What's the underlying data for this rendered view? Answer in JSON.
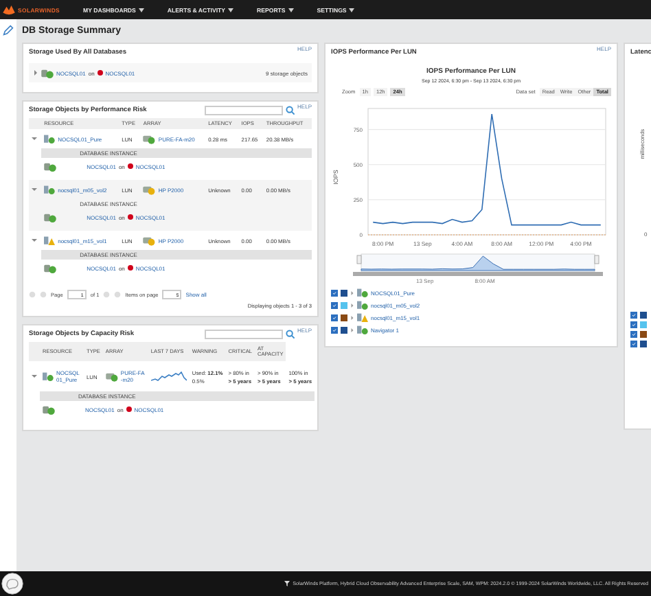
{
  "nav": {
    "logo": "SOLARWINDS",
    "menus": [
      "MY DASHBOARDS",
      "ALERTS & ACTIVITY",
      "REPORTS",
      "SETTINGS"
    ]
  },
  "page_title": "DB Storage Summary",
  "storage_used": {
    "title": "Storage Used By All Databases",
    "help": "HELP",
    "row": {
      "expanded": false,
      "instance": "NOCSQL01",
      "joiner": "on",
      "server": "NOCSQL01",
      "server_down": true,
      "count": "9 storage objects"
    }
  },
  "performance_risk": {
    "title": "Storage Objects by Performance Risk",
    "help": "HELP",
    "columns": [
      "RESOURCE",
      "TYPE",
      "ARRAY",
      "LATENCY",
      "IOPS",
      "THROUGHPUT"
    ],
    "rows": [
      {
        "resource": "NOCSQL01_Pure",
        "resource_warning": false,
        "type": "LUN",
        "array": "PURE-FA-m20",
        "array_warning": false,
        "latency": "0.28 ms",
        "iops": "217.65",
        "throughput": "20.38 MB/s",
        "expanded": true,
        "sub_heading": "DATABASE INSTANCE",
        "instance": "NOCSQL01",
        "joiner": "on",
        "server": "NOCSQL01",
        "server_down": true
      },
      {
        "resource": "nocsql01_m05_vol2",
        "resource_warning": false,
        "type": "LUN",
        "array": "HP P2000",
        "array_warning": true,
        "latency": "Unknown",
        "iops": "0.00",
        "throughput": "0.00 MB/s",
        "expanded": true,
        "sub_heading": "DATABASE INSTANCE",
        "instance": "NOCSQL01",
        "joiner": "on",
        "server": "NOCSQL01",
        "server_down": true
      },
      {
        "resource": "nocsql01_m15_vol1",
        "resource_warning": true,
        "type": "LUN",
        "array": "HP P2000",
        "array_warning": true,
        "latency": "Unknown",
        "iops": "0.00",
        "throughput": "0.00 MB/s",
        "expanded": true,
        "sub_heading": "DATABASE INSTANCE",
        "instance": "NOCSQL01",
        "joiner": "on",
        "server": "NOCSQL01",
        "server_down": true
      }
    ],
    "pager": {
      "page_label": "Page",
      "page": "1",
      "of": "of 1",
      "items_label": "Items on page",
      "items": "5",
      "show_all": "Show all",
      "summary": "Displaying objects 1 - 3 of 3"
    }
  },
  "capacity_risk": {
    "title": "Storage Objects by Capacity Risk",
    "help": "HELP",
    "columns": [
      "RESOURCE",
      "TYPE",
      "ARRAY",
      "LAST 7 DAYS",
      "WARNING",
      "CRITICAL",
      "AT CAPACITY"
    ],
    "rows": [
      {
        "resource": "NOCSQL01_Pure",
        "resource_warning": false,
        "type": "LUN",
        "array": "PURE-FA-m20",
        "array_warning": false,
        "used": "Used: **12.1%**",
        "change": "0.5%",
        "warning": [
          "> 80% in",
          "> 5 years"
        ],
        "critical": [
          "> 90% in",
          "> 5 years"
        ],
        "capacity": [
          "100% in",
          "> 5 years"
        ],
        "expanded": true,
        "sub_heading": "DATABASE INSTANCE",
        "instance": "NOCSQL01",
        "joiner": "on",
        "server": "NOCSQL01",
        "server_down": true
      }
    ]
  },
  "iops": {
    "title": "IOPS Performance Per LUN",
    "help": "HELP",
    "zoom_label": "Zoom",
    "zooms": [
      {
        "label": "1h",
        "selected": false
      },
      {
        "label": "12h",
        "selected": false
      },
      {
        "label": "24h",
        "selected": true
      }
    ],
    "dataset_label": "Data set",
    "datasets": [
      {
        "label": "Read",
        "selected": false
      },
      {
        "label": "Write",
        "selected": false
      },
      {
        "label": "Other",
        "selected": false
      },
      {
        "label": "Total",
        "selected": true
      }
    ],
    "chart_data": {
      "type": "line",
      "title": "IOPS Performance Per LUN",
      "subtitle": "Sep 12 2024, 6:30 pm - Sep 13 2024, 6:30 pm",
      "ylabel": "IOPS",
      "categories": [
        null,
        "8:00 PM",
        null,
        null,
        null,
        "13 Sep",
        null,
        null,
        null,
        "4:00 AM",
        null,
        null,
        null,
        "8:00 AM",
        null,
        null,
        null,
        "12:00 PM",
        null,
        null,
        null,
        "4:00 PM",
        null,
        null
      ],
      "series": [
        {
          "color": "#2f6db3",
          "values": [
            90,
            80,
            90,
            80,
            90,
            90,
            90,
            80,
            110,
            90,
            100,
            180,
            860,
            400,
            70,
            70,
            70,
            70,
            70,
            70,
            90,
            70,
            70,
            70
          ]
        }
      ],
      "ylim": [
        0,
        900
      ],
      "yticks": [
        0,
        250,
        500,
        750
      ],
      "grid": true
    },
    "navigator_labels": [
      "13 Sep",
      "8:00 AM"
    ],
    "legend": [
      {
        "label": "NOCSQL01_Pure",
        "checked": true,
        "color": "#1f4f8f",
        "resource_warning": false
      },
      {
        "label": "nocsql01_m05_vol2",
        "checked": true,
        "color": "#55c3ee",
        "resource_warning": false
      },
      {
        "label": "nocsql01_m15_vol1",
        "checked": true,
        "color": "#8a4a14",
        "resource_warning": true
      },
      {
        "label": "Navigator 1",
        "checked": true,
        "color": "#1f4f8f",
        "resource_warning": false
      }
    ]
  },
  "latency": {
    "title": "Latenc",
    "ylabel": "milliseconds",
    "ytick": "0",
    "legend": [
      {
        "checked": true,
        "color": "#1f4f8f"
      },
      {
        "checked": true,
        "color": "#55c3ee"
      },
      {
        "checked": true,
        "color": "#8a4a14"
      },
      {
        "checked": true,
        "color": "#1f4f8f"
      }
    ]
  },
  "footer": {
    "text": "SolarWinds Platform, Hybrid Cloud Observability Advanced Enterprise Scale, SAM, WPM: 2024.2.0 © 1999-2024 SolarWinds Worldwide, LLC. All Rights Reserved"
  }
}
